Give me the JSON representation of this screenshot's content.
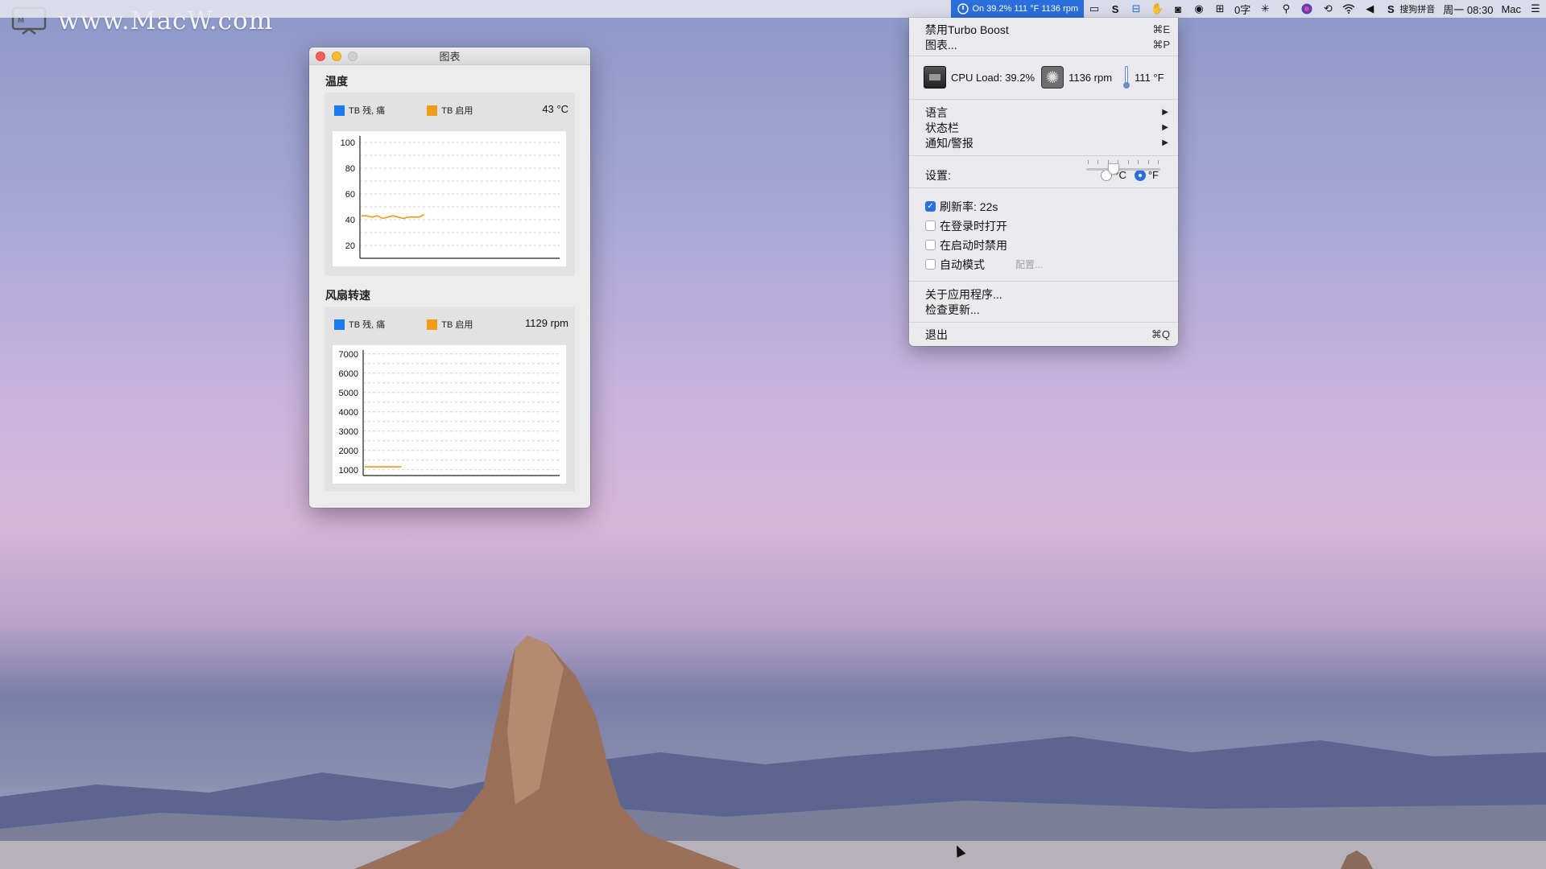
{
  "watermark": {
    "text": "www.MacW.com"
  },
  "menubar": {
    "turbo_status": "On 39.2% 111 °F 1136 rpm",
    "input_text": "0字",
    "ime_label": "搜狗拼音",
    "clock": "周一 08:30",
    "user": "Mac",
    "icons": [
      "turbo-boost-icon",
      "video-icon",
      "s-app-icon",
      "remote-icon",
      "hand-icon",
      "app-icon",
      "alfred-icon",
      "grid-icon",
      "input-icon",
      "brightness-icon",
      "search-icon",
      "siri-icon",
      "time-machine-icon",
      "wifi-icon",
      "volume-icon",
      "sogou-icon",
      "list-icon"
    ]
  },
  "chart_window": {
    "title": "图表",
    "temperature": {
      "section_title": "温度",
      "legend": [
        {
          "label": "TB 残, 痛",
          "color": "#1a7cf0"
        },
        {
          "label": "TB 启用",
          "color": "#f29a1a"
        }
      ],
      "readout": "43 °C"
    },
    "fan": {
      "section_title": "风扇转速",
      "legend": [
        {
          "label": "TB 残, 痛",
          "color": "#1a7cf0"
        },
        {
          "label": "TB 启用",
          "color": "#f29a1a"
        }
      ],
      "readout": "1129 rpm"
    }
  },
  "chart_data": [
    {
      "type": "line",
      "title": "温度",
      "ylim": [
        10,
        105
      ],
      "y_ticks": [
        100,
        80,
        60,
        40,
        20
      ],
      "series": [
        {
          "name": "TB 启用",
          "color": "#f29a1a",
          "values": [
            43,
            43,
            42,
            43,
            41,
            42,
            43,
            42,
            41,
            42,
            42,
            42,
            44
          ]
        }
      ]
    },
    {
      "type": "line",
      "title": "风扇转速",
      "ylim": [
        700,
        7200
      ],
      "y_ticks": [
        7000,
        6000,
        5000,
        4000,
        3000,
        2000,
        1000
      ],
      "series": [
        {
          "name": "TB 启用",
          "color": "#f29a1a",
          "values": [
            1150,
            1150,
            1150,
            1150,
            1150,
            1150,
            1150,
            1150
          ]
        }
      ]
    }
  ],
  "dropdown": {
    "disable_turbo": "禁用Turbo Boost",
    "disable_turbo_shortcut": "⌘E",
    "charts": "图表...",
    "charts_shortcut": "⌘P",
    "cpu_load": "CPU Load: 39.2%",
    "fan_rpm": "1136 rpm",
    "temp_f": "111 °F",
    "language": "语言",
    "status_bar": "状态栏",
    "notifications": "通知/警报",
    "settings_label": "设置:",
    "unit_c": "°C",
    "unit_f": "°F",
    "unit_selected": "°F",
    "refresh": "刷新率: 22s",
    "refresh_checked": true,
    "refresh_level": 0.35,
    "open_at_login": "在登录时打开",
    "disable_at_launch": "在启动时禁用",
    "auto_mode": "自动模式",
    "configure": "配置...",
    "about": "关于应用程序...",
    "check_updates": "检查更新...",
    "quit": "退出",
    "quit_shortcut": "⌘Q"
  }
}
